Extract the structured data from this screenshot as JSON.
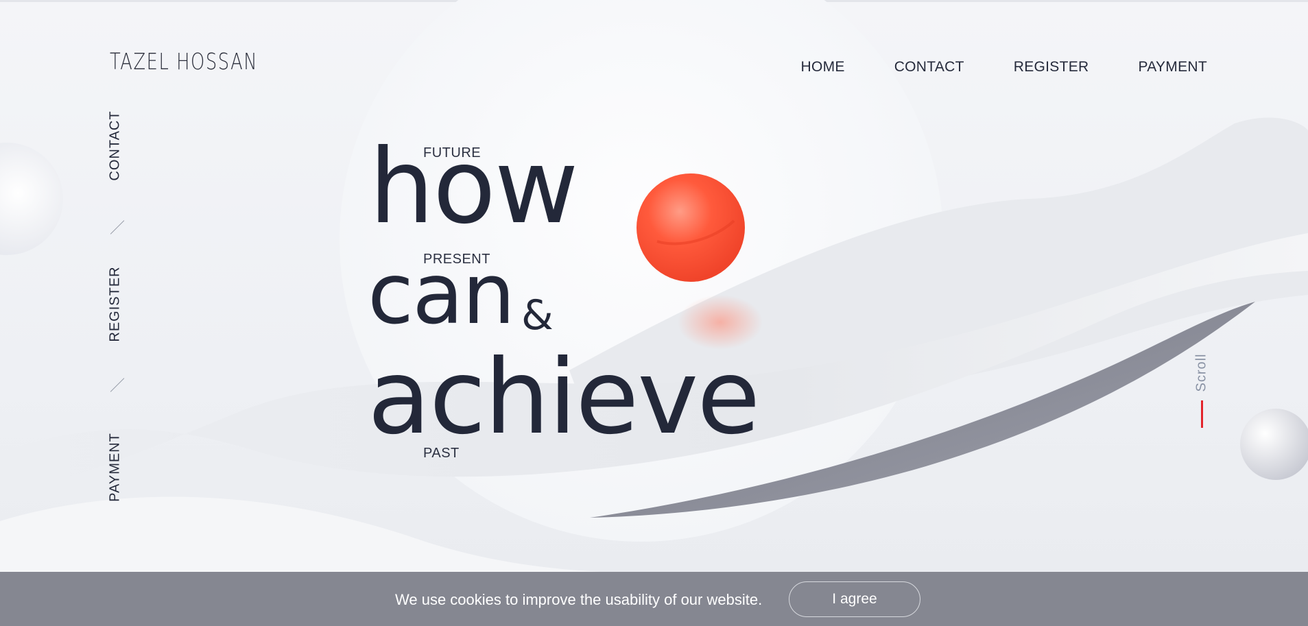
{
  "brand": {
    "logo_text": "TAZEL HOSSAN"
  },
  "top_nav": {
    "items": [
      {
        "label": "HOME"
      },
      {
        "label": "CONTACT"
      },
      {
        "label": "REGISTER"
      },
      {
        "label": "PAYMENT"
      }
    ]
  },
  "side_nav": {
    "items": [
      {
        "label": "CONTACT"
      },
      {
        "label": "REGISTER"
      },
      {
        "label": "PAYMENT"
      }
    ]
  },
  "hero": {
    "labels": {
      "future": "FUTURE",
      "present": "PRESENT",
      "past": "PAST"
    },
    "words": {
      "how": "how",
      "can": "can",
      "amp": "&",
      "achieve": "achieve"
    }
  },
  "scroll": {
    "label": "Scroll",
    "accent_color": "#e3242b"
  },
  "cookie": {
    "message": "We use cookies to improve the usability of our website.",
    "button_label": "I agree"
  },
  "colors": {
    "text_dark": "#232839",
    "sphere_red": "#ff5a3c",
    "cookie_bg": "#858791"
  },
  "icons": {
    "background": "abstract-3d-shapes",
    "ball": "red-sphere-graphic"
  }
}
